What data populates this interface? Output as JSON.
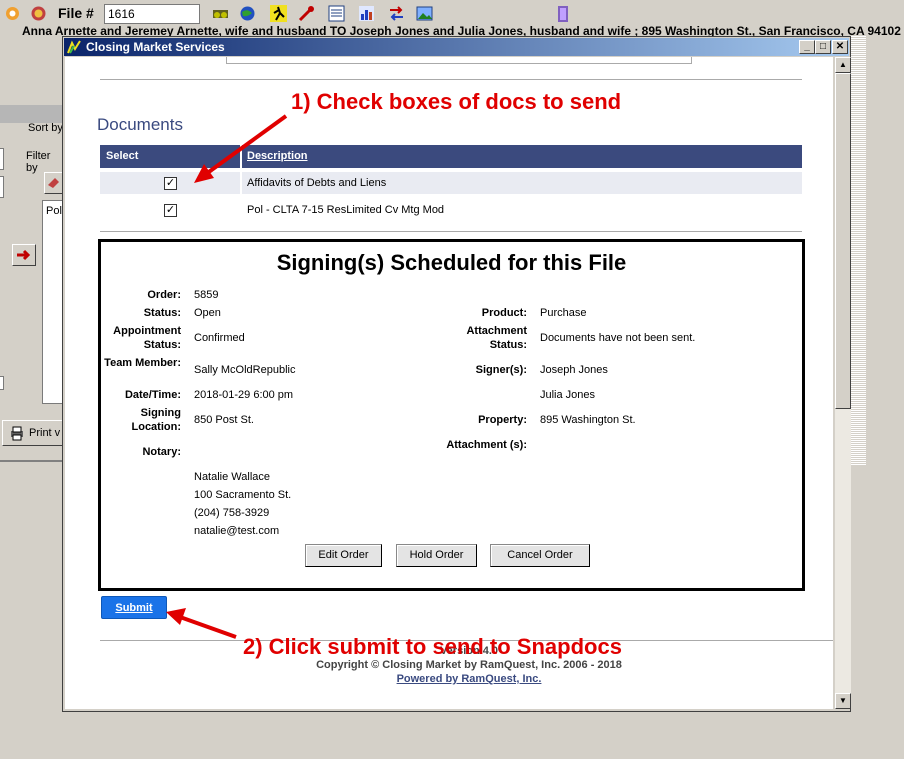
{
  "toolbar": {
    "file_label": "File #",
    "file_number": "1616",
    "parties": "Anna Arnette and Jeremey Arnette, wife and husband TO Joseph Jones and Julia Jones, husband and wife ; 895 Washington St., San Francisco, CA 94102"
  },
  "background_app": {
    "sort_label": "Sort by",
    "filter_label": "Filter by",
    "list_item": "Pol",
    "print_label": "Print v"
  },
  "window": {
    "title": "Closing Market Services",
    "minimize": "_",
    "maximize": "□",
    "close": "✕"
  },
  "documents": {
    "heading": "Documents",
    "col_select": "Select",
    "col_description": "Description",
    "rows": [
      {
        "description": "Affidavits of Debts and Liens",
        "checked": true
      },
      {
        "description": "Pol - CLTA 7-15 ResLimited Cv Mtg Mod",
        "checked": true
      }
    ]
  },
  "signing": {
    "title": "Signing(s) Scheduled for this File",
    "order_label": "Order:",
    "order": "5859",
    "status_label": "Status:",
    "status": "Open",
    "appt_label": "Appointment Status:",
    "appt": "Confirmed",
    "team_label": "Team Member:",
    "team": "Sally McOldRepublic",
    "datetime_label": "Date/Time:",
    "datetime": "2018-01-29 6:00 pm",
    "location_label": "Signing Location:",
    "location": "850 Post St.",
    "notary_label": "Notary:",
    "notary_name": "Natalie Wallace",
    "notary_address": "100 Sacramento St.",
    "notary_phone": "(204) 758-3929",
    "notary_email": "natalie@test.com",
    "product_label": "Product:",
    "product": "Purchase",
    "att_status_label": "Attachment Status:",
    "att_status": "Documents have not been sent.",
    "signers_label": "Signer(s):",
    "signer1": "Joseph Jones",
    "signer2": "Julia Jones",
    "property_label": "Property:",
    "property": "895 Washington St.",
    "attachments_label": "Attachment (s):",
    "buttons": {
      "edit": "Edit Order",
      "hold": "Hold Order",
      "cancel": "Cancel Order"
    }
  },
  "submit_label": "Submit",
  "footer": {
    "version": "Version 4.0",
    "copyright": "Copyright © Closing Market by RamQuest, Inc. 2006 - 2018",
    "powered": "Powered by RamQuest, Inc."
  },
  "annotations": {
    "step1": "1) Check boxes of docs to send",
    "step2": "2) Click submit to send to Snapdocs",
    "color": "#e00000"
  }
}
